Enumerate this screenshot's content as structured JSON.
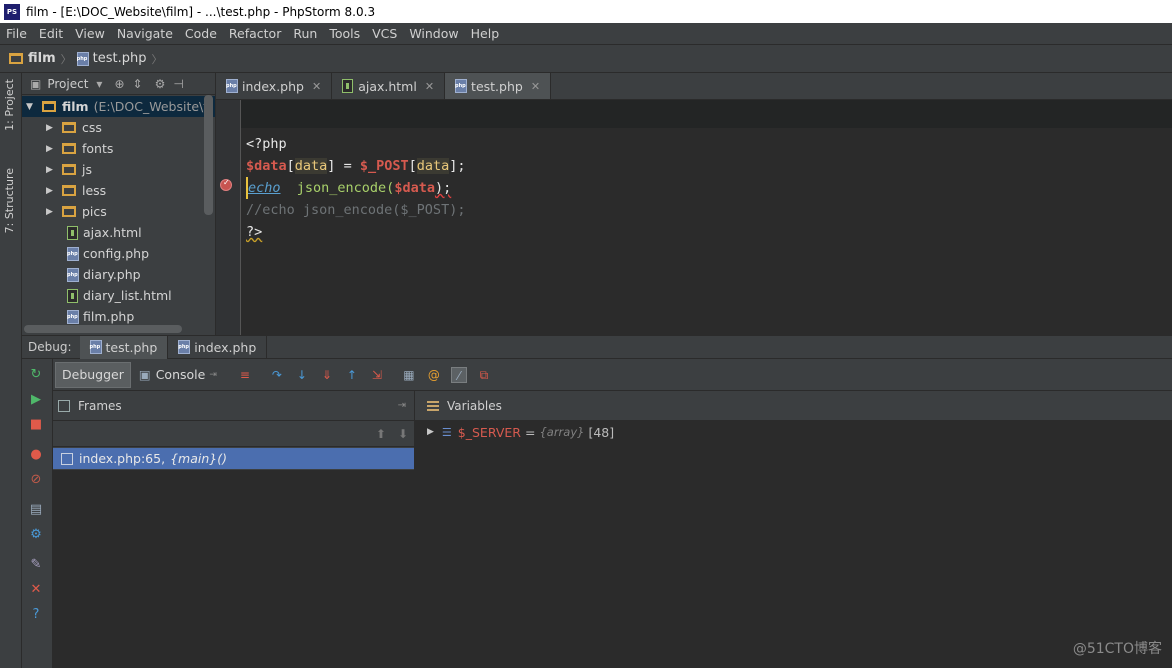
{
  "window": {
    "title": "film - [E:\\DOC_Website\\film] - ...\\test.php - PhpStorm 8.0.3",
    "app_icon_label": "PS"
  },
  "menu": [
    "File",
    "Edit",
    "View",
    "Navigate",
    "Code",
    "Refactor",
    "Run",
    "Tools",
    "VCS",
    "Window",
    "Help"
  ],
  "breadcrumb": {
    "project": "film",
    "file": "test.php"
  },
  "left_strip": {
    "project_tab": "1: Project",
    "structure_tab": "7: Structure"
  },
  "project_panel": {
    "header": "Project",
    "root": {
      "name": "film",
      "path": "(E:\\DOC_Website\\fi"
    },
    "folders": [
      "css",
      "fonts",
      "js",
      "less",
      "pics"
    ],
    "files": [
      {
        "name": "ajax.html",
        "type": "html"
      },
      {
        "name": "config.php",
        "type": "php"
      },
      {
        "name": "diary.php",
        "type": "php"
      },
      {
        "name": "diary_list.html",
        "type": "html"
      },
      {
        "name": "film.php",
        "type": "php"
      }
    ]
  },
  "editor_tabs": [
    {
      "label": "index.php",
      "type": "php",
      "active": false
    },
    {
      "label": "ajax.html",
      "type": "html",
      "active": false
    },
    {
      "label": "test.php",
      "type": "php",
      "active": true
    }
  ],
  "code": {
    "line1": "<?php",
    "line2": {
      "var": "$data",
      "lb": "[",
      "key": "data",
      "rb": "]",
      "eq": " = ",
      "post": "$_POST",
      "lb2": "[",
      "key2": "data",
      "rb2": "];"
    },
    "line3": {
      "kw": "echo",
      "fn": "  json_encode(",
      "var": "$data",
      "end": ");"
    },
    "line4": "//echo json_encode($_POST);",
    "line5": "?>"
  },
  "debug": {
    "label": "Debug:",
    "tabs": [
      {
        "label": "test.php",
        "active": true
      },
      {
        "label": "index.php",
        "active": false
      }
    ],
    "toolbar_tabs": [
      "Debugger",
      "Console"
    ],
    "frames": {
      "title": "Frames",
      "row": {
        "location": "index.php:65,",
        "function": "{main}()"
      }
    },
    "variables": {
      "title": "Variables",
      "row": {
        "name": "$_SERVER",
        "eq": "=",
        "type": "{array}",
        "count": "[48]"
      }
    }
  },
  "watermark": "@51CTO博客",
  "colors": {
    "accent_selection": "#4b6eaf",
    "variable": "#d65a4f",
    "keyword": "#5aa0d0"
  }
}
